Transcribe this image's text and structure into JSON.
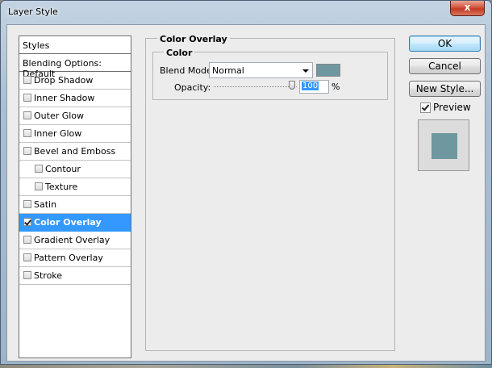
{
  "window": {
    "title": "Layer Style",
    "close_glyph": "x"
  },
  "styles_panel": {
    "header": "Styles",
    "blending_options": "Blending Options: Default",
    "items": [
      {
        "label": "Drop Shadow",
        "checked": false
      },
      {
        "label": "Inner Shadow",
        "checked": false
      },
      {
        "label": "Outer Glow",
        "checked": false
      },
      {
        "label": "Inner Glow",
        "checked": false
      },
      {
        "label": "Bevel and Emboss",
        "checked": false
      },
      {
        "label": "Contour",
        "checked": false,
        "indent": true
      },
      {
        "label": "Texture",
        "checked": false,
        "indent": true
      },
      {
        "label": "Satin",
        "checked": false
      },
      {
        "label": "Color Overlay",
        "checked": true,
        "selected": true
      },
      {
        "label": "Gradient Overlay",
        "checked": false
      },
      {
        "label": "Pattern Overlay",
        "checked": false
      },
      {
        "label": "Stroke",
        "checked": false
      }
    ]
  },
  "color_overlay": {
    "section_title": "Color Overlay",
    "group_title": "Color",
    "blend_mode_label": "Blend Mode:",
    "blend_mode_value": "Normal",
    "overlay_color": "#6e97a0",
    "opacity_label": "Opacity:",
    "opacity_value": "100",
    "opacity_unit": "%"
  },
  "buttons": {
    "ok": "OK",
    "cancel": "Cancel",
    "new_style": "New Style..."
  },
  "preview": {
    "label": "Preview",
    "checked": true,
    "swatch_color": "#6e97a0"
  },
  "colors": {
    "selection": "#3399ff",
    "dialog_bg": "#ececec",
    "titlebar": "#aabfd3",
    "close_button": "#c23b22"
  }
}
